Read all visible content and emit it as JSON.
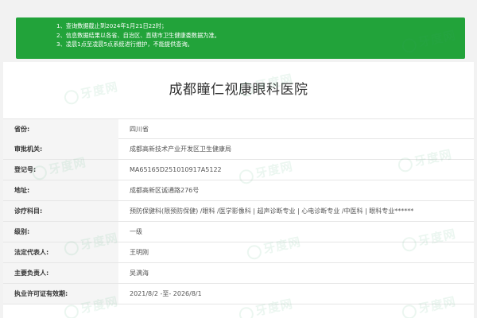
{
  "notice": {
    "lines": [
      "1、查询数据截止到2024年1月21日22时；",
      "2、信息数据结果以各省、自治区、直辖市卫生健康委数据为准。",
      "3、凌晨1点至凌晨5点系统进行维护，不能提供查询。"
    ]
  },
  "hospital": {
    "title": "成都瞳仁视康眼科医院"
  },
  "watermark": {
    "text": "牙度网"
  },
  "rows": [
    {
      "label": "省份:",
      "value": "四川省"
    },
    {
      "label": "审批机关:",
      "value": "成都高新技术产业开发区卫生健康局"
    },
    {
      "label": "登记号:",
      "value": "MA65165D251010917A5122"
    },
    {
      "label": "地址:",
      "value": "成都高新区诚通路276号"
    },
    {
      "label": "诊疗科目:",
      "value": "预防保健科(限预防保健) /眼科 /医学影像科 | 超声诊断专业 | 心电诊断专业 /中医科 | 眼科专业******"
    },
    {
      "label": "级别:",
      "value": "一级"
    },
    {
      "label": "法定代表人:",
      "value": "王明刚"
    },
    {
      "label": "主要负责人:",
      "value": "吴满海"
    },
    {
      "label": "执业许可证有效期:",
      "value": "2021/8/2 -至- 2026/8/1"
    }
  ]
}
